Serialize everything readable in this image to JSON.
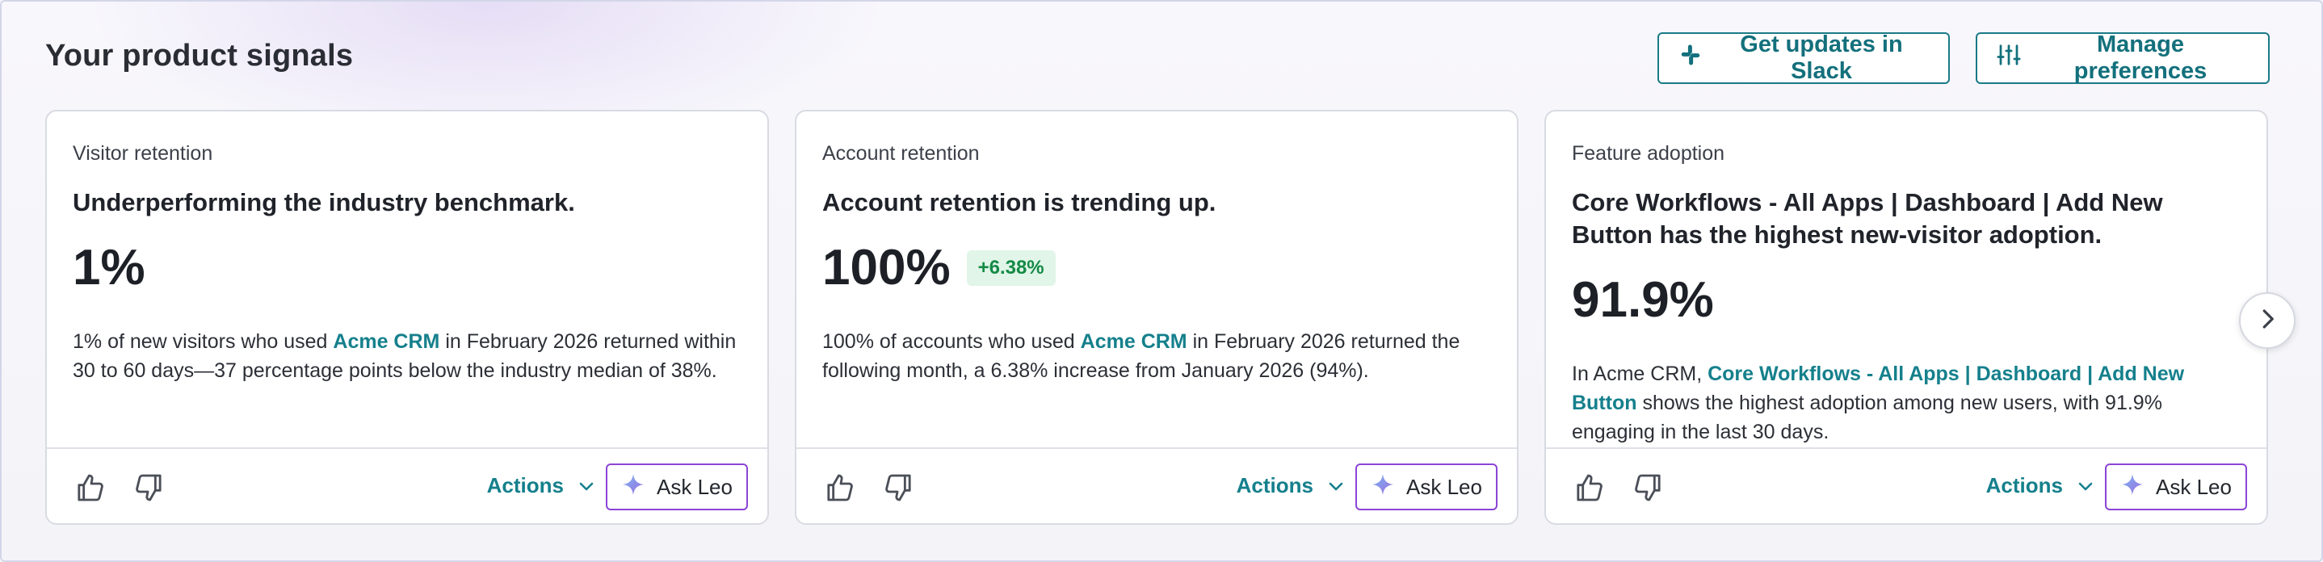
{
  "header": {
    "title": "Your product signals",
    "slack_button": "Get updates in Slack",
    "preferences_button": "Manage preferences"
  },
  "cards": [
    {
      "category": "Visitor retention",
      "title": "Underperforming the industry benchmark.",
      "metric": "1%",
      "delta": "",
      "desc_before": "1% of new visitors who used ",
      "desc_link": "Acme CRM",
      "desc_after": " in February 2026 returned within 30 to 60 days—37 percentage points below the industry median of 38%."
    },
    {
      "category": "Account retention",
      "title": "Account retention is trending up.",
      "metric": "100%",
      "delta": "+6.38%",
      "desc_before": "100% of accounts who used ",
      "desc_link": "Acme CRM",
      "desc_after": " in February 2026 returned the following month, a 6.38% increase from January 2026 (94%)."
    },
    {
      "category": "Feature adoption",
      "title": "Core Workflows - All Apps | Dashboard | Add New Button has the highest new-visitor adoption.",
      "metric": "91.9%",
      "delta": "",
      "desc_before": "In Acme CRM, ",
      "desc_link": "Core Workflows - All Apps | Dashboard | Add New Button",
      "desc_after": " shows the highest adoption among new users, with 91.9% engaging in the last 30 days."
    }
  ],
  "footer": {
    "actions_label": "Actions",
    "ask_label": "Ask Leo"
  },
  "icons": {
    "slack": "slack-icon",
    "preferences": "sliders-icon",
    "thumbs_up": "thumbs-up-icon",
    "thumbs_down": "thumbs-down-icon",
    "chevron": "chevron-down-icon",
    "sparkle": "sparkle-icon",
    "next": "chevron-right-icon"
  },
  "colors": {
    "accent_teal": "#15808c",
    "ask_border_purple": "#8b44d6",
    "delta_green": "#148a46",
    "delta_bg": "#e1f5e8"
  }
}
